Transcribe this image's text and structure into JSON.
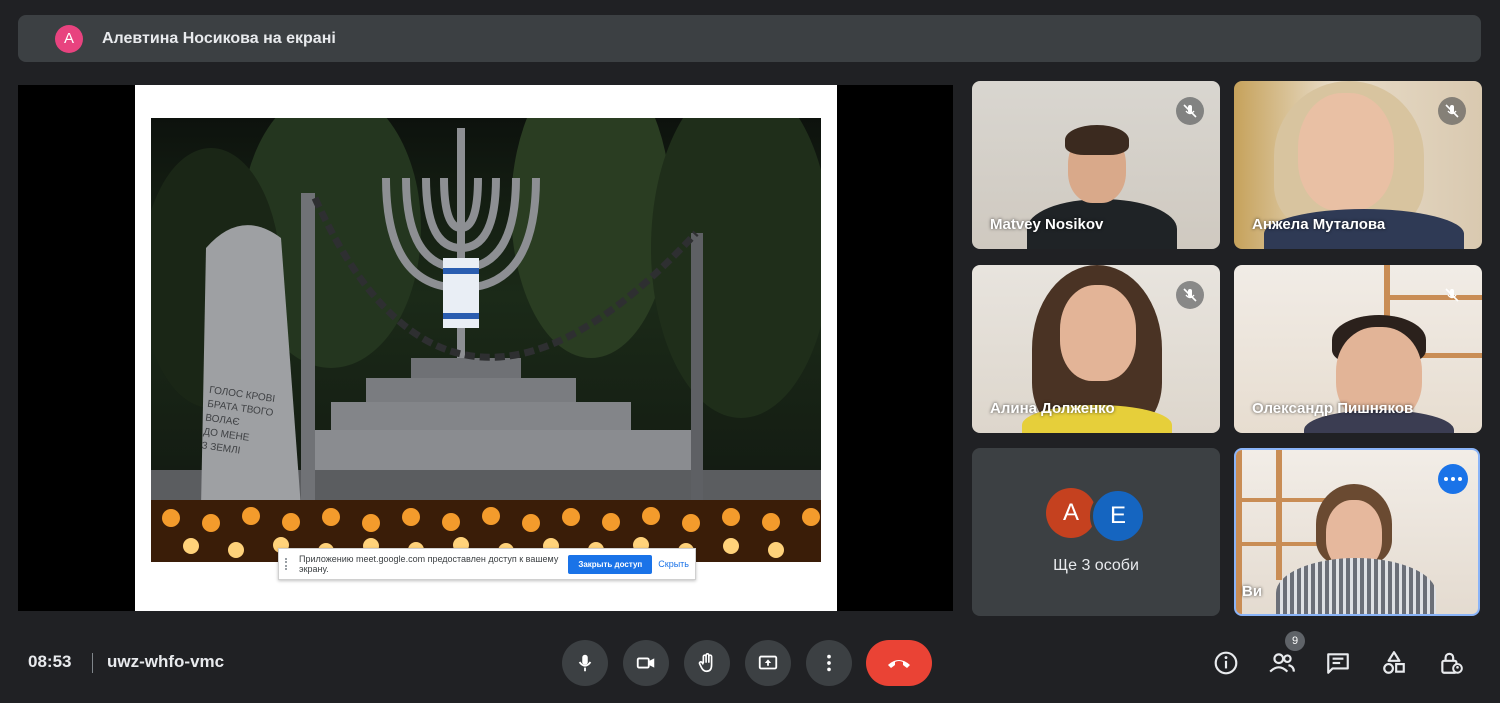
{
  "banner": {
    "avatar_letter": "А",
    "title": "Алевтина Носикова на екрані"
  },
  "slide": {
    "inscription_lines": [
      "ГОЛОС КРОВІ",
      "БРАТА ТВОГО",
      "ВОЛАЄ",
      "ДО МЕНЕ",
      "З ЗЕМЛІ"
    ],
    "share_bar": {
      "text": "Приложению meet.google.com предоставлен доступ к вашему экрану.",
      "stop_label": "Закрыть доступ",
      "hide_label": "Скрыть"
    }
  },
  "participants": [
    {
      "name": "Matvey Nosikov",
      "muted": true
    },
    {
      "name": "Анжела Муталова",
      "muted": true
    },
    {
      "name": "Алина Долженко",
      "muted": true
    },
    {
      "name": "Олександр Пишняков",
      "muted": true
    },
    {
      "name": "Ви",
      "muted": false
    }
  ],
  "others": {
    "avatars": [
      "А",
      "Е"
    ],
    "label": "Ще 3 особи",
    "colors": [
      "#c5411f",
      "#1565c0"
    ]
  },
  "meeting": {
    "time": "08:53",
    "code": "uwz-whfo-vmc"
  },
  "controls": [
    "mic-icon",
    "camera-icon",
    "hand-icon",
    "present-icon",
    "more-vert-icon",
    "end-call-icon"
  ],
  "right_controls": {
    "people_count": "9",
    "icons": [
      "info-icon",
      "people-icon",
      "chat-icon",
      "activities-icon",
      "lock-person-icon"
    ]
  },
  "colors": {
    "accent": "#1a73e8",
    "end_call": "#ea4335",
    "bar_bg": "#202124",
    "tile_bg": "#3c4043"
  }
}
